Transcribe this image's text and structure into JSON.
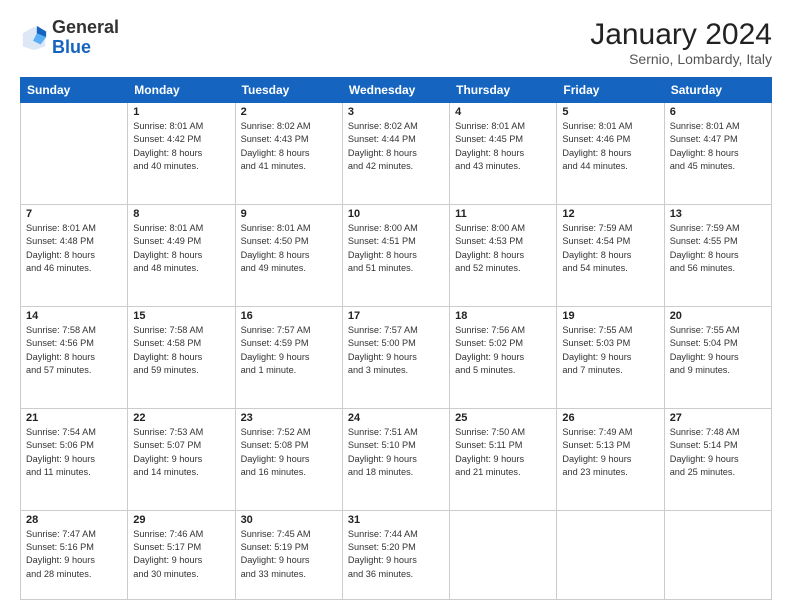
{
  "header": {
    "logo": {
      "general": "General",
      "blue": "Blue"
    },
    "title": "January 2024",
    "location": "Sernio, Lombardy, Italy"
  },
  "weekdays": [
    "Sunday",
    "Monday",
    "Tuesday",
    "Wednesday",
    "Thursday",
    "Friday",
    "Saturday"
  ],
  "weeks": [
    [
      {
        "day": "",
        "info": ""
      },
      {
        "day": "1",
        "info": "Sunrise: 8:01 AM\nSunset: 4:42 PM\nDaylight: 8 hours\nand 40 minutes."
      },
      {
        "day": "2",
        "info": "Sunrise: 8:02 AM\nSunset: 4:43 PM\nDaylight: 8 hours\nand 41 minutes."
      },
      {
        "day": "3",
        "info": "Sunrise: 8:02 AM\nSunset: 4:44 PM\nDaylight: 8 hours\nand 42 minutes."
      },
      {
        "day": "4",
        "info": "Sunrise: 8:01 AM\nSunset: 4:45 PM\nDaylight: 8 hours\nand 43 minutes."
      },
      {
        "day": "5",
        "info": "Sunrise: 8:01 AM\nSunset: 4:46 PM\nDaylight: 8 hours\nand 44 minutes."
      },
      {
        "day": "6",
        "info": "Sunrise: 8:01 AM\nSunset: 4:47 PM\nDaylight: 8 hours\nand 45 minutes."
      }
    ],
    [
      {
        "day": "7",
        "info": "Sunrise: 8:01 AM\nSunset: 4:48 PM\nDaylight: 8 hours\nand 46 minutes."
      },
      {
        "day": "8",
        "info": "Sunrise: 8:01 AM\nSunset: 4:49 PM\nDaylight: 8 hours\nand 48 minutes."
      },
      {
        "day": "9",
        "info": "Sunrise: 8:01 AM\nSunset: 4:50 PM\nDaylight: 8 hours\nand 49 minutes."
      },
      {
        "day": "10",
        "info": "Sunrise: 8:00 AM\nSunset: 4:51 PM\nDaylight: 8 hours\nand 51 minutes."
      },
      {
        "day": "11",
        "info": "Sunrise: 8:00 AM\nSunset: 4:53 PM\nDaylight: 8 hours\nand 52 minutes."
      },
      {
        "day": "12",
        "info": "Sunrise: 7:59 AM\nSunset: 4:54 PM\nDaylight: 8 hours\nand 54 minutes."
      },
      {
        "day": "13",
        "info": "Sunrise: 7:59 AM\nSunset: 4:55 PM\nDaylight: 8 hours\nand 56 minutes."
      }
    ],
    [
      {
        "day": "14",
        "info": "Sunrise: 7:58 AM\nSunset: 4:56 PM\nDaylight: 8 hours\nand 57 minutes."
      },
      {
        "day": "15",
        "info": "Sunrise: 7:58 AM\nSunset: 4:58 PM\nDaylight: 8 hours\nand 59 minutes."
      },
      {
        "day": "16",
        "info": "Sunrise: 7:57 AM\nSunset: 4:59 PM\nDaylight: 9 hours\nand 1 minute."
      },
      {
        "day": "17",
        "info": "Sunrise: 7:57 AM\nSunset: 5:00 PM\nDaylight: 9 hours\nand 3 minutes."
      },
      {
        "day": "18",
        "info": "Sunrise: 7:56 AM\nSunset: 5:02 PM\nDaylight: 9 hours\nand 5 minutes."
      },
      {
        "day": "19",
        "info": "Sunrise: 7:55 AM\nSunset: 5:03 PM\nDaylight: 9 hours\nand 7 minutes."
      },
      {
        "day": "20",
        "info": "Sunrise: 7:55 AM\nSunset: 5:04 PM\nDaylight: 9 hours\nand 9 minutes."
      }
    ],
    [
      {
        "day": "21",
        "info": "Sunrise: 7:54 AM\nSunset: 5:06 PM\nDaylight: 9 hours\nand 11 minutes."
      },
      {
        "day": "22",
        "info": "Sunrise: 7:53 AM\nSunset: 5:07 PM\nDaylight: 9 hours\nand 14 minutes."
      },
      {
        "day": "23",
        "info": "Sunrise: 7:52 AM\nSunset: 5:08 PM\nDaylight: 9 hours\nand 16 minutes."
      },
      {
        "day": "24",
        "info": "Sunrise: 7:51 AM\nSunset: 5:10 PM\nDaylight: 9 hours\nand 18 minutes."
      },
      {
        "day": "25",
        "info": "Sunrise: 7:50 AM\nSunset: 5:11 PM\nDaylight: 9 hours\nand 21 minutes."
      },
      {
        "day": "26",
        "info": "Sunrise: 7:49 AM\nSunset: 5:13 PM\nDaylight: 9 hours\nand 23 minutes."
      },
      {
        "day": "27",
        "info": "Sunrise: 7:48 AM\nSunset: 5:14 PM\nDaylight: 9 hours\nand 25 minutes."
      }
    ],
    [
      {
        "day": "28",
        "info": "Sunrise: 7:47 AM\nSunset: 5:16 PM\nDaylight: 9 hours\nand 28 minutes."
      },
      {
        "day": "29",
        "info": "Sunrise: 7:46 AM\nSunset: 5:17 PM\nDaylight: 9 hours\nand 30 minutes."
      },
      {
        "day": "30",
        "info": "Sunrise: 7:45 AM\nSunset: 5:19 PM\nDaylight: 9 hours\nand 33 minutes."
      },
      {
        "day": "31",
        "info": "Sunrise: 7:44 AM\nSunset: 5:20 PM\nDaylight: 9 hours\nand 36 minutes."
      },
      {
        "day": "",
        "info": ""
      },
      {
        "day": "",
        "info": ""
      },
      {
        "day": "",
        "info": ""
      }
    ]
  ]
}
